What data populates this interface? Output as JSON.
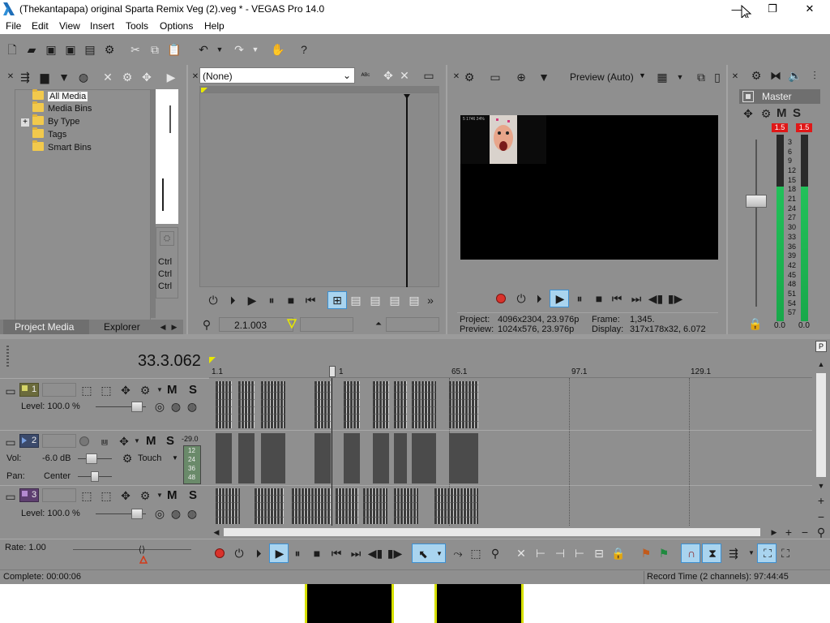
{
  "window": {
    "title": "(Thekantapapa) original Sparta Remix Veg (2).veg * - VEGAS Pro 14.0",
    "minimize": "—",
    "maximize": "❐",
    "close": "✕"
  },
  "menu": [
    "File",
    "Edit",
    "View",
    "Insert",
    "Tools",
    "Options",
    "Help"
  ],
  "project_media": {
    "tree": [
      {
        "label": "All Media",
        "expander": ""
      },
      {
        "label": "Media Bins",
        "expander": ""
      },
      {
        "label": "By Type",
        "expander": "+"
      },
      {
        "label": "Tags",
        "expander": ""
      },
      {
        "label": "Smart Bins",
        "expander": ""
      }
    ],
    "tabs": [
      "Project Media",
      "Explorer"
    ],
    "ctrl_labels": [
      "Ctrl",
      "Ctrl",
      "Ctrl"
    ]
  },
  "trimmer": {
    "dropdown_value": "(None)",
    "position": "2.1.003"
  },
  "preview": {
    "quality": "Preview (Auto)",
    "project_label": "Project:",
    "project_value": "4096x2304, 23.976p",
    "preview_label": "Preview:",
    "preview_value": "1024x576, 23.976p",
    "frame_label": "Frame:",
    "frame_value": "1,345.",
    "display_label": "Display:",
    "display_value": "317x178x32, 6.072",
    "thumb_text": "5 1746 24%"
  },
  "master": {
    "label": "Master",
    "mute": "M",
    "solo": "S",
    "peak_left": "1.5",
    "peak_right": "1.5",
    "scale": [
      "3",
      "6",
      "9",
      "12",
      "15",
      "18",
      "21",
      "24",
      "27",
      "30",
      "33",
      "36",
      "39",
      "42",
      "45",
      "48",
      "51",
      "54",
      "57"
    ],
    "level_left": "0.0",
    "level_right": "0.0",
    "meter_fill_fraction": 0.72
  },
  "timeline": {
    "current_time": "33.3.062",
    "ruler_labels": [
      "1.1",
      "1",
      "65.1",
      "97.1",
      "129.1"
    ],
    "tracks": [
      {
        "number": "1",
        "type": "video",
        "level_label": "Level: 100.0 %",
        "m": "M",
        "s": "S"
      },
      {
        "number": "2",
        "type": "audio",
        "vol_label": "Vol:",
        "vol_value": "-6.0 dB",
        "pan_label": "Pan:",
        "pan_value": "Center",
        "automation": "Touch",
        "meter_top": "-29.0",
        "meter_scale": [
          "12",
          "24",
          "36",
          "48"
        ],
        "m": "M",
        "s": "S"
      },
      {
        "number": "3",
        "type": "video",
        "level_label": "Level: 100.0 %",
        "m": "M",
        "s": "S"
      }
    ],
    "rate_label": "Rate: 1.00"
  },
  "status": {
    "complete": "Complete: 00:00:06",
    "record_time": "Record Time (2 channels): 97:44:45"
  },
  "colors": {
    "background": "#8f8f8f",
    "panel_dark": "#6f6f6f",
    "meter_green": "#22c15a",
    "peak_red": "#e01818",
    "highlight": "#a9d4ef"
  }
}
